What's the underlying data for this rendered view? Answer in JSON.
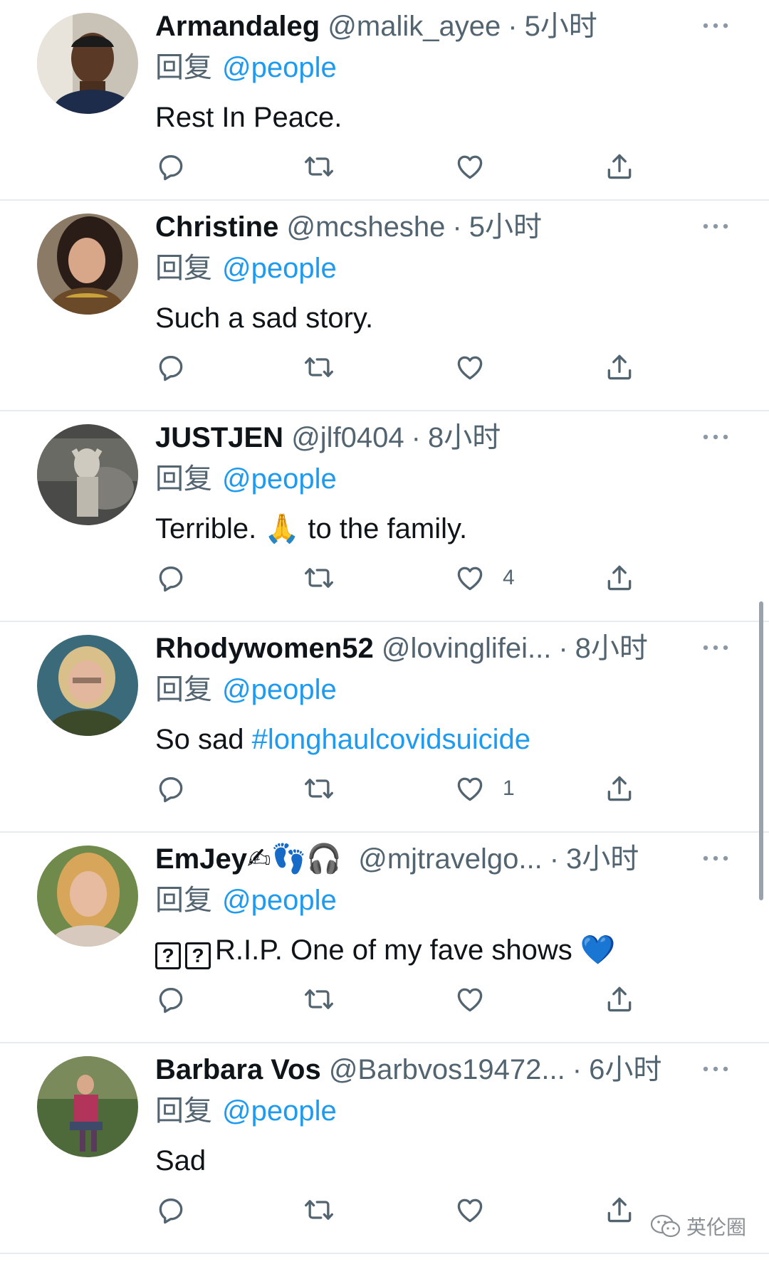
{
  "tweets": [
    {
      "name": "Armandaleg",
      "handle": "@malik_ayee",
      "time": "5小时",
      "reply_prefix": "回复",
      "mention": "@people",
      "text": "Rest In Peace.",
      "like_count": ""
    },
    {
      "name": "Christine",
      "handle": "@mcsheshe",
      "time": "5小时",
      "reply_prefix": "回复",
      "mention": "@people",
      "text": "Such a sad story.",
      "like_count": ""
    },
    {
      "name": "JUSTJEN",
      "handle": "@jlf0404",
      "time": "8小时",
      "reply_prefix": "回复",
      "mention": "@people",
      "text_before": "Terrible.",
      "text_emoji": "🙏",
      "text_after": "to the family.",
      "like_count": "4"
    },
    {
      "name": "Rhodywomen52",
      "handle": "@lovinglifei...",
      "time": "8小时",
      "reply_prefix": "回复",
      "mention": "@people",
      "text": "So sad",
      "hashtag": "#longhaulcovidsuicide",
      "like_count": "1"
    },
    {
      "name": "EmJey",
      "name_emoji": "✍👣🎧",
      "handle": "@mjtravelgo...",
      "time": "3小时",
      "reply_prefix": "回复",
      "mention": "@people",
      "text_boxes": [
        "?",
        "?"
      ],
      "text": "R.I.P. One of my fave shows",
      "text_emoji": "💙",
      "like_count": ""
    },
    {
      "name": "Barbara Vos",
      "handle": "@Barbvos19472...",
      "time": "6小时",
      "reply_prefix": "回复",
      "mention": "@people",
      "text": "Sad",
      "like_count": ""
    }
  ],
  "separator": "·",
  "icons": {
    "more": "more-icon",
    "reply": "reply-icon",
    "retweet": "retweet-icon",
    "like": "like-icon",
    "share": "share-icon"
  },
  "colors": {
    "link": "#1d9bf0",
    "secondary": "#536471",
    "text": "#0f1419",
    "divider": "#e6ecf0"
  },
  "watermark": {
    "text": "英伦圈"
  }
}
